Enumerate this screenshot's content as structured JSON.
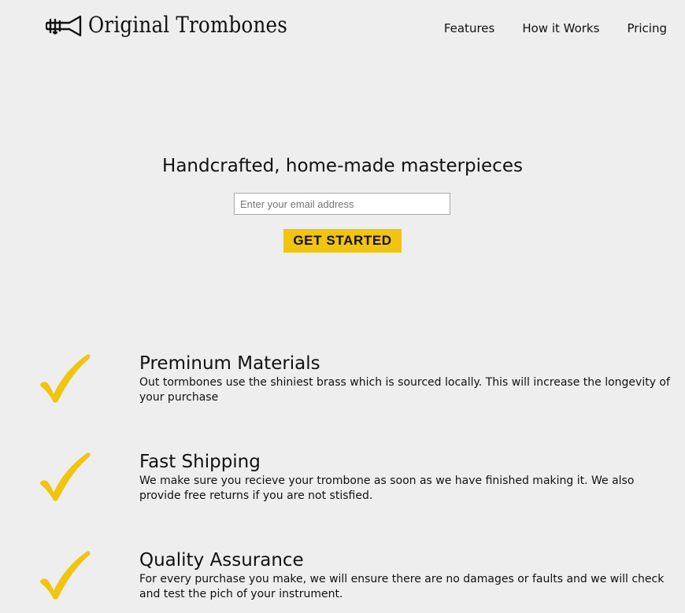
{
  "brand": {
    "name": "Original Trombones",
    "logo_icon": "trombone-icon"
  },
  "nav": {
    "items": [
      {
        "label": "Features"
      },
      {
        "label": "How it Works"
      },
      {
        "label": "Pricing"
      }
    ]
  },
  "hero": {
    "title": "Handcrafted, home-made masterpieces",
    "email_placeholder": "Enter your email address",
    "email_value": "",
    "cta_label": "GET STARTED"
  },
  "features": [
    {
      "icon": "checkmark-icon",
      "title": "Preminum Materials",
      "description": "Out tormbones use the shiniest brass which is sourced locally. This will increase the longevity of your purchase"
    },
    {
      "icon": "checkmark-icon",
      "title": "Fast Shipping",
      "description": "We make sure you recieve your trombone as soon as we have finished making it. We also provide free returns if you are not stisfied."
    },
    {
      "icon": "checkmark-icon",
      "title": "Quality Assurance",
      "description": "For every purchase you make, we will ensure there are no damages or faults and we will check and test the pich of your instrument."
    }
  ],
  "colors": {
    "background": "#eeeeee",
    "accent": "#f1c40f",
    "text": "#111111"
  }
}
